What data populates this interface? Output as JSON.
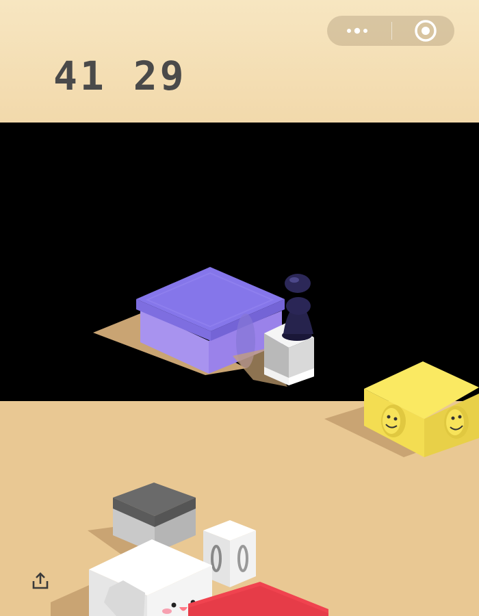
{
  "game": {
    "score": "41 29"
  },
  "capsule": {
    "more_icon": "more-dots-icon",
    "close_icon": "target-close-icon"
  },
  "share": {
    "icon": "share-upload-icon"
  },
  "colors": {
    "header_bg": "#f5dfb5",
    "ground": "#e9c893",
    "score_text": "#4a4a4a",
    "purple_box": "#8e7ff0",
    "yellow_box": "#f7e35a",
    "red_box": "#f0434f",
    "player": "#1e1b3d"
  }
}
